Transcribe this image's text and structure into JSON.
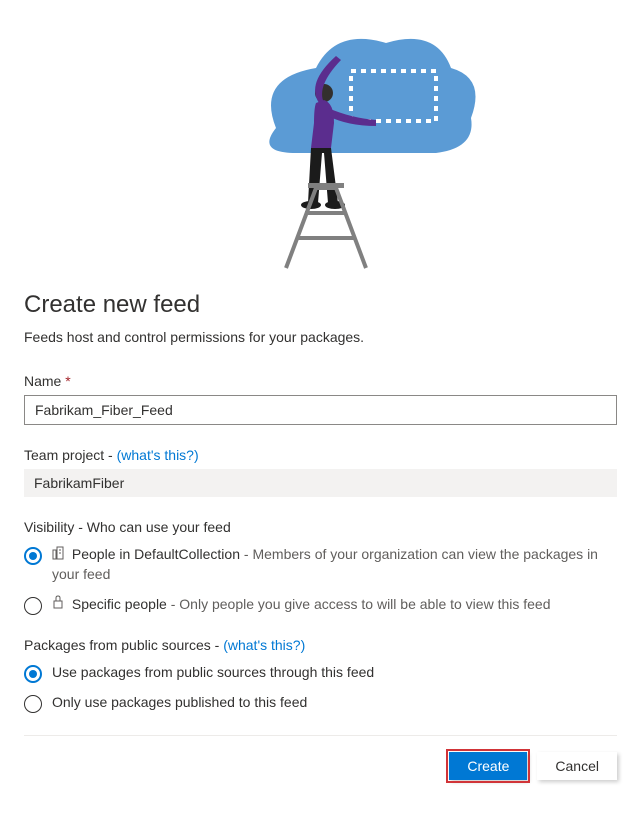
{
  "header": {
    "title": "Create new feed",
    "subtitle": "Feeds host and control permissions for your packages."
  },
  "name_field": {
    "label": "Name",
    "required_marker": "*",
    "value": "Fabrikam_Fiber_Feed"
  },
  "team_project": {
    "label": "Team project -",
    "help_link": "(what's this?)",
    "value": "FabrikamFiber"
  },
  "visibility": {
    "section_label": "Visibility - Who can use your feed",
    "options": [
      {
        "label": "People in DefaultCollection",
        "separator": " - ",
        "description": "Members of your organization can view the packages in your feed",
        "selected": true
      },
      {
        "label": "Specific people",
        "separator": " - ",
        "description": "Only people you give access to will be able to view this feed",
        "selected": false
      }
    ]
  },
  "packages": {
    "section_label": "Packages from public sources -",
    "help_link": "(what's this?)",
    "options": [
      {
        "label": "Use packages from public sources through this feed",
        "selected": true
      },
      {
        "label": "Only use packages published to this feed",
        "selected": false
      }
    ]
  },
  "buttons": {
    "create": "Create",
    "cancel": "Cancel"
  }
}
